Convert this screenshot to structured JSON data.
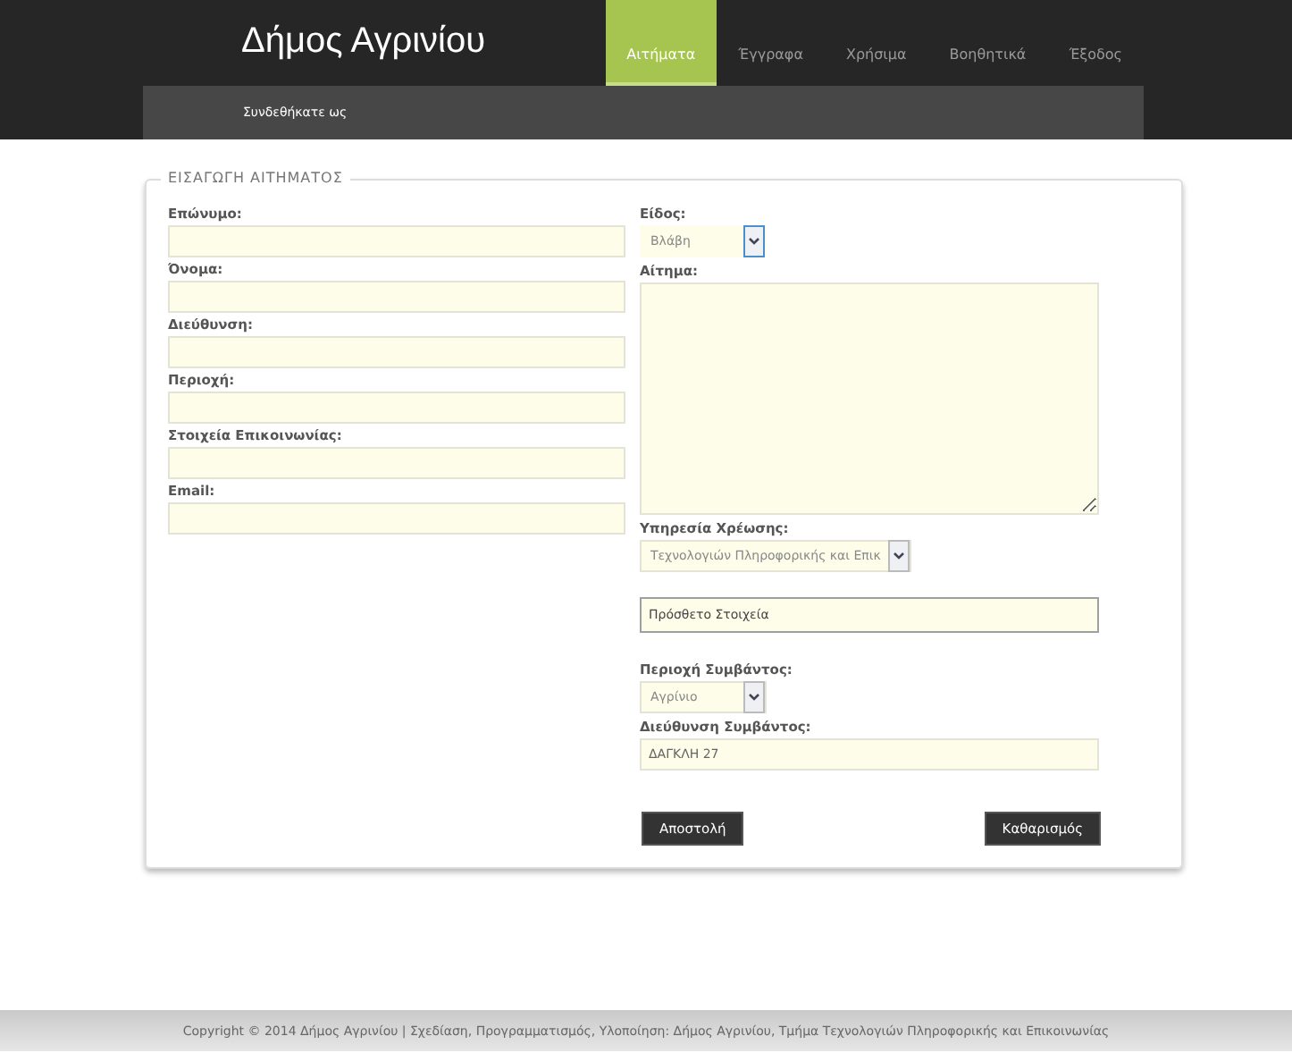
{
  "header": {
    "title": "Δήμος Αγρινίου",
    "logged_in": "Συνδεθήκατε ως",
    "nav": [
      {
        "label": "Αιτήματα",
        "selected": true
      },
      {
        "label": "Έγγραφα",
        "selected": false
      },
      {
        "label": "Χρήσιμα",
        "selected": false
      },
      {
        "label": "Βοηθητικά",
        "selected": false
      },
      {
        "label": "Έξοδος",
        "selected": false
      }
    ]
  },
  "form": {
    "legend": "ΕΙΣΑΓΩΓΗ ΑΙΤΗΜΑΤΟΣ",
    "left_fields": [
      {
        "kind": "input",
        "label": "Επώνυμο:"
      },
      {
        "kind": "input",
        "label": "Όνομα:"
      },
      {
        "kind": "input",
        "label": "Διεύθυνση:"
      },
      {
        "kind": "input",
        "label": "Περιοχή:"
      },
      {
        "kind": "input",
        "label": "Στοιχεία Επικοινωνίας:"
      },
      {
        "kind": "input",
        "label": "Email:"
      }
    ],
    "right_fields": [
      {
        "kind": "select",
        "label": "Είδος:",
        "value": "Βλάβη",
        "focused": true
      },
      {
        "kind": "textarea",
        "label": "Αίτημα:"
      },
      {
        "kind": "select",
        "label": "Υπηρεσία Χρέωσης:",
        "value": "Τεχνολογιών Πληροφορικής και Επικ",
        "focused": false
      },
      {
        "kind": "boxed",
        "value": "Πρόσθετο Στοιχεία"
      },
      {
        "kind": "select",
        "label": "Περιοχή Συμβάντος:",
        "value": "Αγρίνιο",
        "focused": false
      },
      {
        "kind": "input",
        "label": "Διεύθυνση Συμβάντος:",
        "value": "ΔΑΓΚΛΗ 27"
      }
    ],
    "buttons": [
      "Αποστολή",
      "Καθαρισμός"
    ]
  },
  "footer": {
    "text": "Copyright © 2014 Δήμος Αγρινίου | Σχεδίαση, Προγραμματισμός, Υλοποίηση: Δήμος Αγρινίου, Τμήμα Τεχνολογιών Πληροφορικής και Επικοινωνίας"
  }
}
